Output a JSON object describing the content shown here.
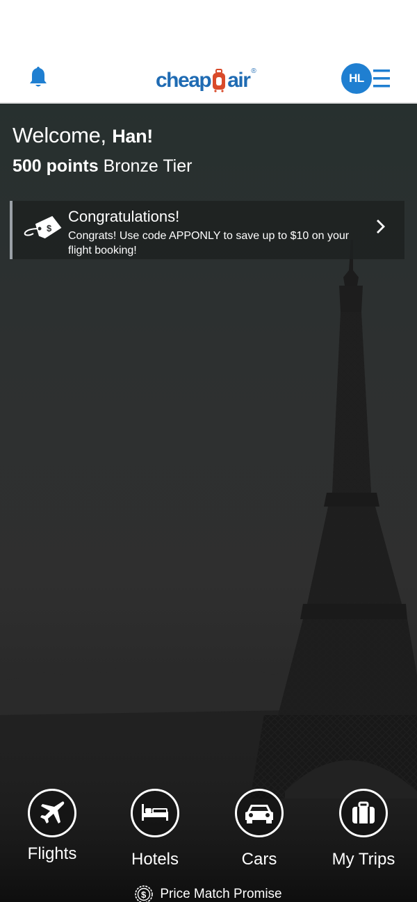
{
  "header": {
    "logo_text_left": "cheap",
    "logo_text_right": "air",
    "logo_reg": "®",
    "avatar_initials": "HL",
    "brand_color": "#1f6bb3",
    "accent_color": "#d94a2a"
  },
  "welcome": {
    "greeting": "Welcome,",
    "name": "Han!",
    "points": "500 points",
    "tier": "Bronze Tier"
  },
  "promo": {
    "icon": "price-tag-icon",
    "title": "Congratulations!",
    "message": "Congrats! Use code APPONLY to save up to $10 on your flight booking!"
  },
  "nav": [
    {
      "label": "Flights",
      "icon": "airplane-icon"
    },
    {
      "label": "Hotels",
      "icon": "bed-icon"
    },
    {
      "label": "Cars",
      "icon": "car-icon"
    },
    {
      "label": "My Trips",
      "icon": "suitcase-icon"
    }
  ],
  "footer": {
    "price_match": "Price Match Promise",
    "icon": "dollar-seal-icon"
  }
}
